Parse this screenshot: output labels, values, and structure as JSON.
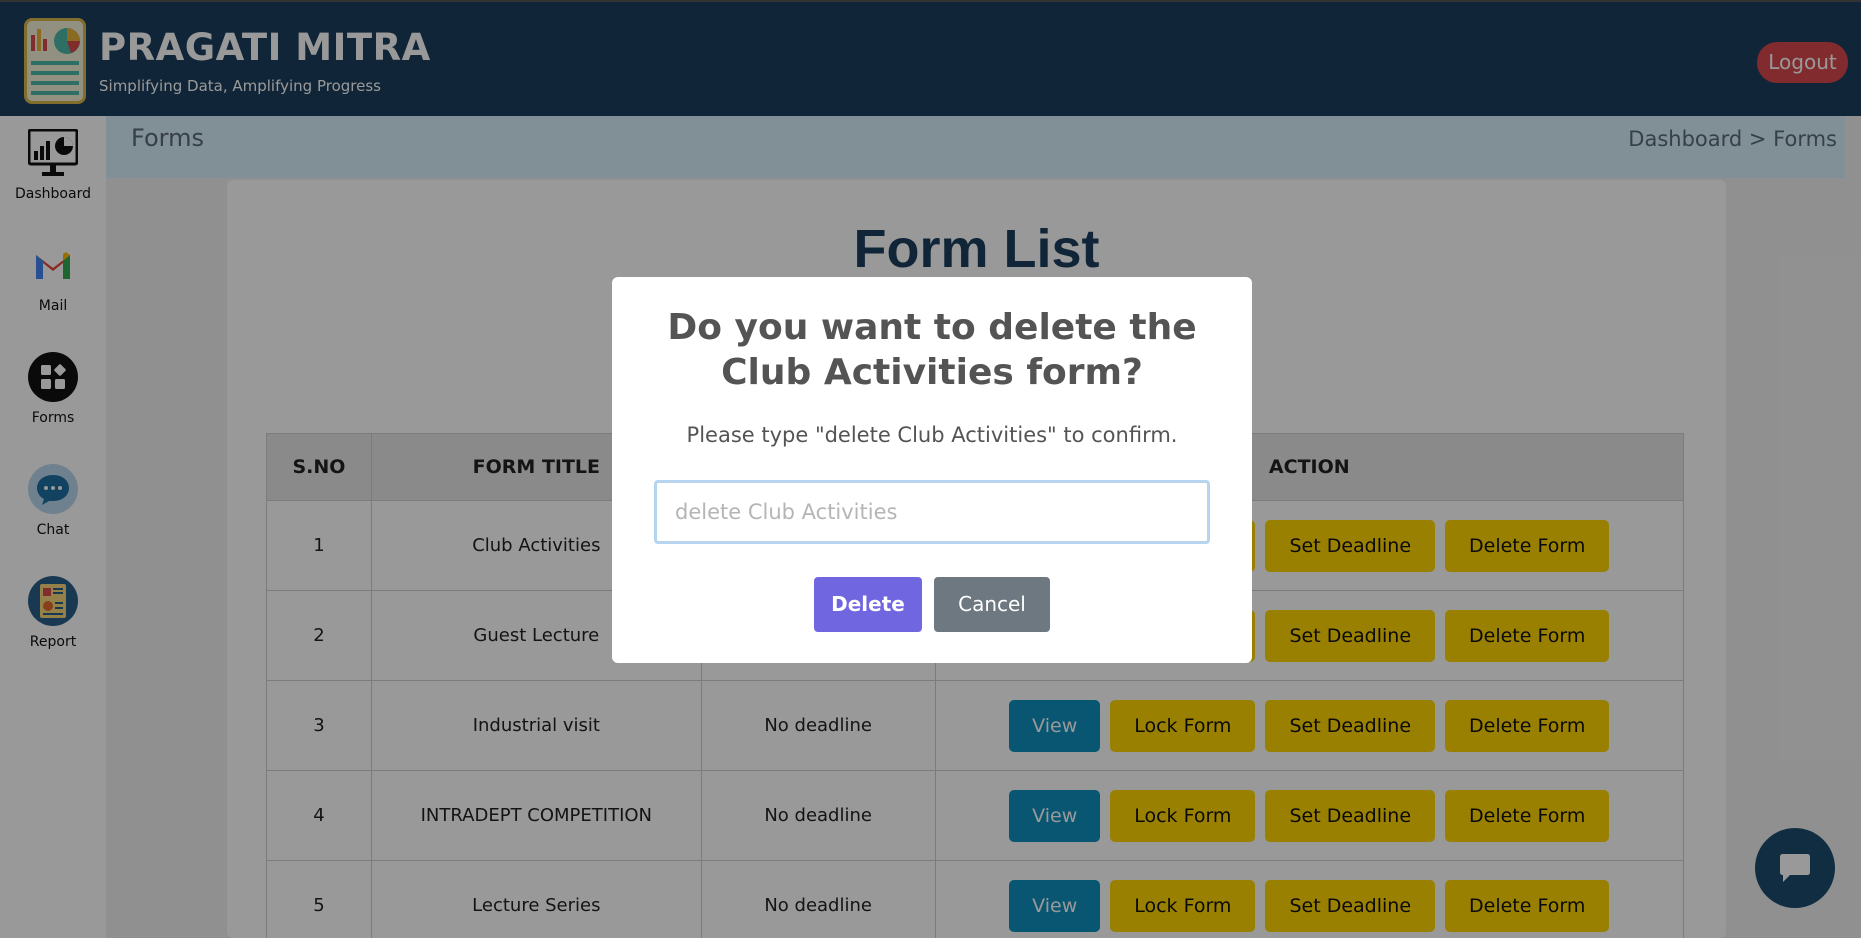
{
  "header": {
    "brand_title": "PRAGATI MITRA",
    "brand_subtitle": "Simplifying Data, Amplifying Progress",
    "logout_label": "Logout"
  },
  "sidebar": {
    "items": [
      {
        "label": "Dashboard",
        "icon": "dashboard-icon"
      },
      {
        "label": "Mail",
        "icon": "mail-icon"
      },
      {
        "label": "Forms",
        "icon": "forms-icon"
      },
      {
        "label": "Chat",
        "icon": "chat-icon"
      },
      {
        "label": "Report",
        "icon": "report-icon"
      }
    ]
  },
  "page": {
    "title": "Forms",
    "breadcrumb": "Dashboard > Forms",
    "card_title": "Form List"
  },
  "table": {
    "headers": [
      "S.NO",
      "FORM TITLE",
      "",
      "ACTION"
    ],
    "rows": [
      {
        "sno": "1",
        "title": "Club Activities",
        "deadline": ""
      },
      {
        "sno": "2",
        "title": "Guest Lecture",
        "deadline": ""
      },
      {
        "sno": "3",
        "title": "Industrial visit",
        "deadline": "No deadline"
      },
      {
        "sno": "4",
        "title": "INTRADEPT COMPETITION",
        "deadline": "No deadline"
      },
      {
        "sno": "5",
        "title": "Lecture Series",
        "deadline": "No deadline"
      }
    ],
    "actions": {
      "view": "View",
      "lock": "Lock Form",
      "set_deadline": "Set Deadline",
      "delete": "Delete Form"
    }
  },
  "modal": {
    "title_line1": "Do you want to delete the",
    "title_line2": "Club Activities form?",
    "instruction": "Please type \"delete Club Activities\" to confirm.",
    "input_value": "",
    "input_placeholder": "delete Club Activities",
    "delete_label": "Delete",
    "cancel_label": "Cancel"
  },
  "colors": {
    "header_bg": "#1c3e5c",
    "logout_bg": "#d9484f",
    "view_btn": "#0f8fbf",
    "yellow_btn": "#ffd600",
    "modal_delete": "#7066e0",
    "modal_cancel": "#6e7881"
  }
}
